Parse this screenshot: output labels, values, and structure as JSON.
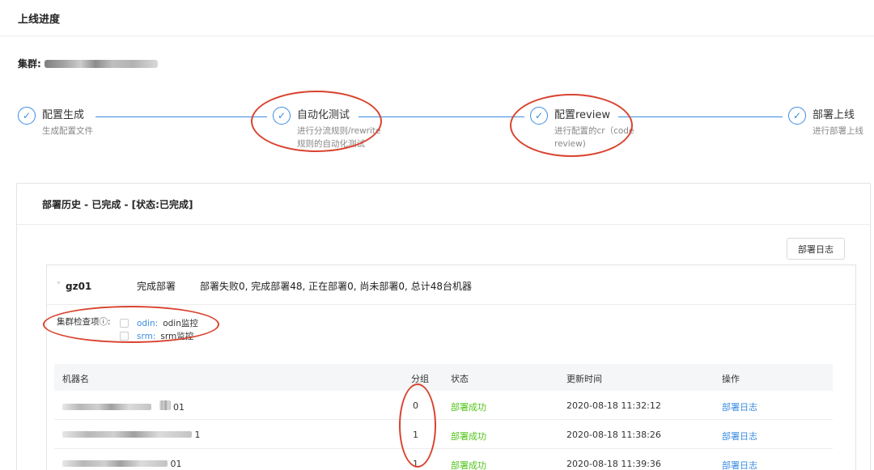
{
  "page": {
    "title": "上线进度"
  },
  "cluster": {
    "label": "集群:",
    "value_suffix": ""
  },
  "steps": [
    {
      "title": "配置生成",
      "desc": [
        "生成配置文件"
      ]
    },
    {
      "title": "自动化测试",
      "desc": [
        "进行分流规则/rewrite",
        "规则的自动化测试"
      ]
    },
    {
      "title": "配置review",
      "desc": [
        "进行配置的cr（code",
        "review)"
      ]
    },
    {
      "title": "部署上线",
      "desc": [
        "进行部署上线"
      ]
    }
  ],
  "panel": {
    "title": "部署历史 - 已完成 - [状态:已完成]",
    "log_button": "部署日志"
  },
  "group": {
    "name": "gz01",
    "status": "完成部署",
    "summary": "部署失败0, 完成部署48, 正在部署0, 尚未部署0, 总计48台机器",
    "checks_label": "集群检查项ⓘ:",
    "checks": [
      {
        "key": "odin:",
        "value": "odin监控"
      },
      {
        "key": "srm:",
        "value": "srm监控"
      }
    ]
  },
  "table": {
    "headers": {
      "name": "机器名",
      "group": "分组",
      "status": "状态",
      "time": "更新时间",
      "action": "操作"
    },
    "rows": [
      {
        "name_tail": "01",
        "group": "0",
        "status": "部署成功",
        "time": "2020-08-18 11:32:12",
        "action": "部署日志"
      },
      {
        "name_tail": "1",
        "group": "1",
        "status": "部署成功",
        "time": "2020-08-18 11:38:26",
        "action": "部署日志"
      },
      {
        "name_tail": "01",
        "group": "1",
        "status": "部署成功",
        "time": "2020-08-18 11:39:36",
        "action": "部署日志"
      }
    ]
  },
  "colors": {
    "accent": "#3b8de0",
    "success": "#52c41a",
    "annotation": "#d9432f"
  }
}
